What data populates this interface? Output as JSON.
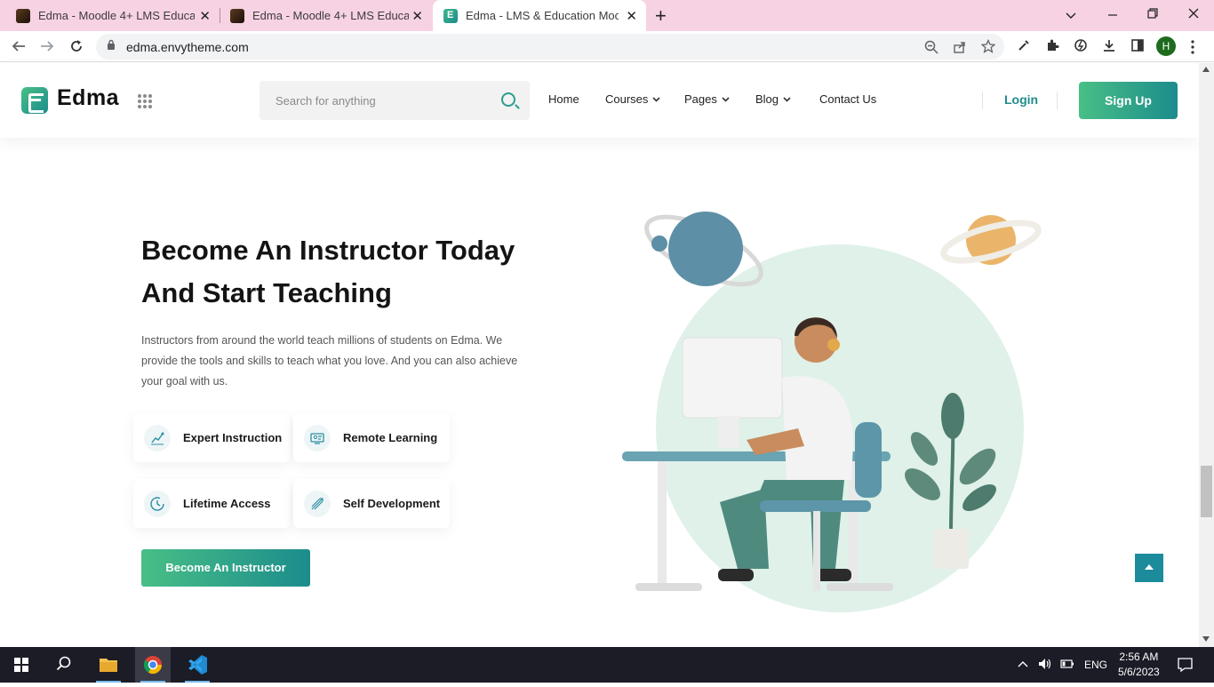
{
  "browser": {
    "tabs": [
      {
        "title": "Edma - Moodle 4+ LMS Education",
        "close": "✕"
      },
      {
        "title": "Edma - Moodle 4+ LMS Education",
        "close": "✕"
      },
      {
        "title": "Edma - LMS & Education Moodle",
        "close": "✕"
      }
    ],
    "new_tab": "+",
    "url": "edma.envytheme.com",
    "profile_initial": "H"
  },
  "header": {
    "logo_text": "Edma",
    "search_placeholder": "Search for anything",
    "nav": [
      {
        "label": "Home",
        "dropdown": false
      },
      {
        "label": "Courses",
        "dropdown": true
      },
      {
        "label": "Pages",
        "dropdown": true
      },
      {
        "label": "Blog",
        "dropdown": true
      },
      {
        "label": "Contact Us",
        "dropdown": false
      }
    ],
    "login": "Login",
    "signup": "Sign Up"
  },
  "hero": {
    "title_line1": "Become An Instructor Today",
    "title_line2": "And Start Teaching",
    "description": "Instructors from around the world teach millions of students on Edma. We provide the tools and skills to teach what you love. And you can also achieve your goal with us.",
    "features": [
      {
        "label": "Expert Instruction",
        "icon": "expert-instruction-icon"
      },
      {
        "label": "Remote Learning",
        "icon": "remote-learning-icon"
      },
      {
        "label": "Lifetime Access",
        "icon": "clock-icon"
      },
      {
        "label": "Self Development",
        "icon": "self-development-icon"
      }
    ],
    "cta": "Become An Instructor"
  },
  "taskbar": {
    "language": "ENG",
    "time": "2:56 AM",
    "date": "5/6/2023"
  },
  "colors": {
    "brand_start": "#48bf86",
    "brand_end": "#1c8c8c",
    "tabbar": "#f7d2e3"
  }
}
